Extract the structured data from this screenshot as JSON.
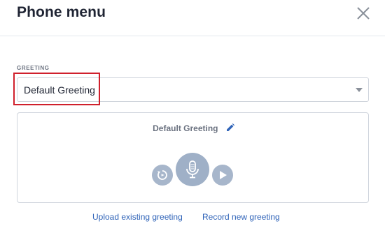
{
  "dialog": {
    "title": "Phone menu",
    "close_icon": "close-icon"
  },
  "greeting": {
    "label": "GREETING",
    "selected": "Default Greeting"
  },
  "panel": {
    "title": "Default Greeting",
    "edit_icon": "pencil-icon",
    "controls": {
      "replay_icon": "replay-icon",
      "mic_icon": "microphone-icon",
      "play_icon": "play-icon"
    }
  },
  "actions": {
    "upload_label": "Upload existing greeting",
    "record_label": "Record new greeting"
  },
  "colors": {
    "highlight": "#d0202c",
    "link": "#2f63b8",
    "control": "#a7b6cb",
    "edit_icon": "#2f63b8"
  }
}
